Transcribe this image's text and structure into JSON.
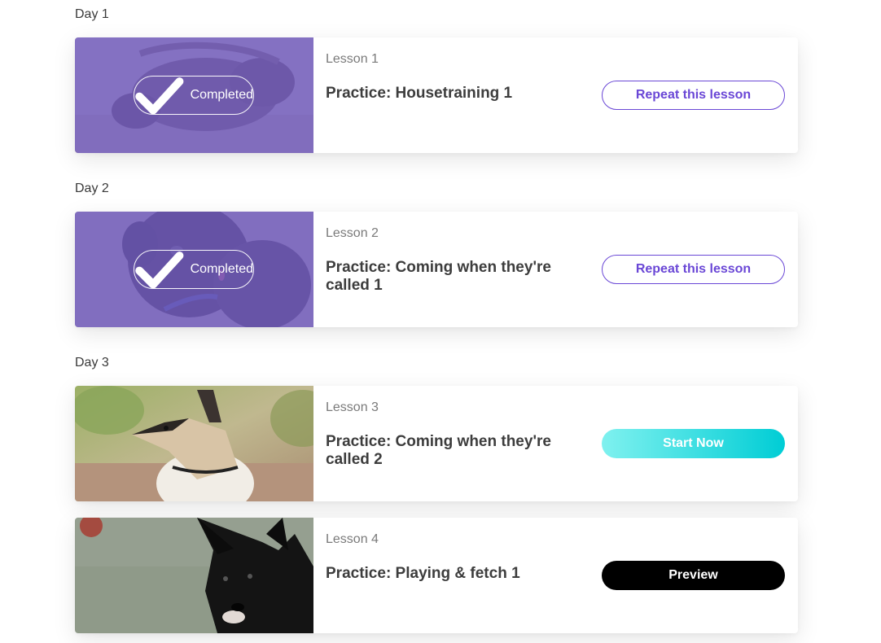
{
  "days": [
    {
      "label": "Day 1"
    },
    {
      "label": "Day 2"
    },
    {
      "label": "Day 3"
    }
  ],
  "lessons": [
    {
      "number": "Lesson 1",
      "title": "Practice: Housetraining 1",
      "status": "Completed",
      "button": "Repeat this lesson",
      "thumb_icon": "dog-photo"
    },
    {
      "number": "Lesson 2",
      "title": "Practice: Coming when they're called 1",
      "status": "Completed",
      "button": "Repeat this lesson",
      "thumb_icon": "dog-photo"
    },
    {
      "number": "Lesson 3",
      "title": "Practice: Coming when they're called 2",
      "button": "Start Now",
      "thumb_icon": "dog-photo"
    },
    {
      "number": "Lesson 4",
      "title": "Practice: Playing & fetch 1",
      "button": "Preview",
      "thumb_icon": "dog-photo"
    }
  ],
  "colors": {
    "accent_purple": "#6a47d6",
    "completed_overlay": "#755fc4",
    "start_gradient_from": "#7ff1ef",
    "start_gradient_to": "#00cdd5",
    "preview_bg": "#000000"
  }
}
